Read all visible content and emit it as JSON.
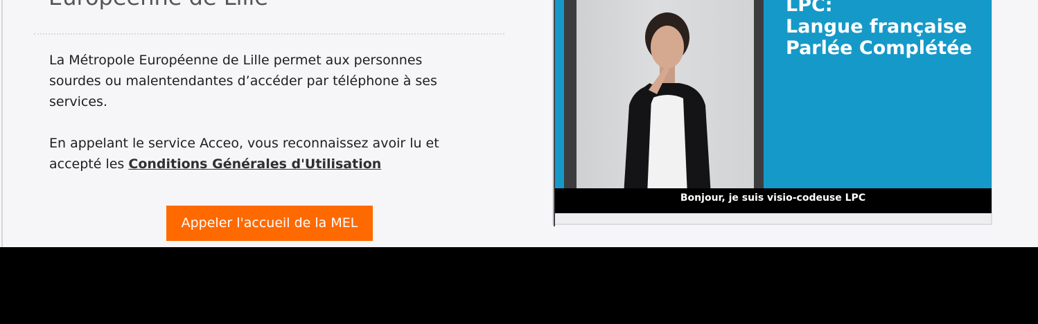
{
  "section": {
    "heading": "Européenne de Lille",
    "intro_text": "La Métropole Européenne de Lille permet aux personnes sourdes ou malentendantes d’accéder par téléphone à ses services.",
    "consent_prefix": "En appelant le service Acceo, vous reconnaissez avoir lu et accepté les ",
    "cgu_link_label": "Conditions Générales d'Utilisation",
    "call_button_label": "Appeler l'accueil de la MEL"
  },
  "video": {
    "panel_text": "LPC:\nLangue française\nParlée Complétée",
    "subtitle": "Bonjour, je suis visio-codeuse LPC"
  },
  "colors": {
    "accent_button": "#ff6a00",
    "video_blue": "#1599c8",
    "page_background": "#f6f6f8"
  }
}
